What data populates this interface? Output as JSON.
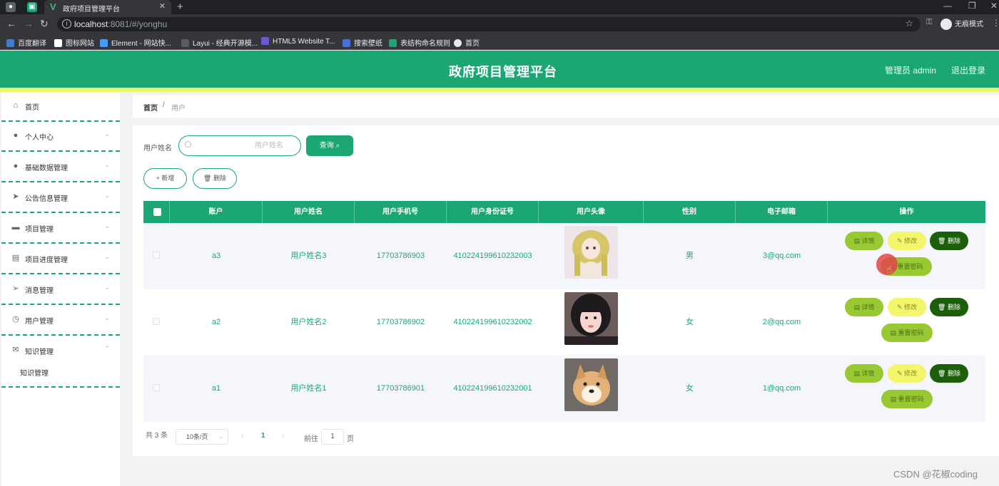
{
  "browser": {
    "tab_title": "政府项目管理平台",
    "url_host": "localhost",
    "url_rest": ":8081/#/yonghu",
    "incognito_label": "无痕模式",
    "bookmarks": [
      "百度翻译",
      "图标网站",
      "Element - 网站快...",
      "Layui - 经典开源模...",
      "HTML5 Website T...",
      "搜索壁纸",
      "表结构命名规则",
      "首页"
    ]
  },
  "header": {
    "title": "政府项目管理平台",
    "user": "管理员 admin",
    "logout": "退出登录"
  },
  "sidebar": {
    "items": [
      {
        "label": "首页",
        "icon": "home-icon"
      },
      {
        "label": "个人中心",
        "icon": "user-icon"
      },
      {
        "label": "基础数据管理",
        "icon": "user-icon"
      },
      {
        "label": "公告信息管理",
        "icon": "send-icon"
      },
      {
        "label": "项目管理",
        "icon": "chat-icon"
      },
      {
        "label": "项目进度管理",
        "icon": "clipboard-icon"
      },
      {
        "label": "消息管理",
        "icon": "send-icon"
      },
      {
        "label": "用户管理",
        "icon": "clock-icon"
      },
      {
        "label": "知识管理",
        "icon": "mail-icon"
      }
    ],
    "sub_item": "知识管理"
  },
  "breadcrumb": {
    "home": "首页",
    "separator": "/",
    "current": "用户"
  },
  "search": {
    "label": "用户姓名",
    "placeholder": "用户姓名",
    "button": "查询"
  },
  "actions": {
    "add": "+ 新增",
    "delete": "删除"
  },
  "table": {
    "columns": [
      "账户",
      "用户姓名",
      "用户手机号",
      "用户身份证号",
      "用户头像",
      "性别",
      "电子邮箱",
      "操作"
    ],
    "rows": [
      {
        "account": "a3",
        "name": "用户姓名3",
        "phone": "17703786903",
        "id_card": "410224199610232003",
        "gender": "男",
        "email": "3@qq.com",
        "avatar": "anime-doll-avatar"
      },
      {
        "account": "a2",
        "name": "用户姓名2",
        "phone": "17703786902",
        "id_card": "410224199610232002",
        "gender": "女",
        "email": "2@qq.com",
        "avatar": "girl-portrait-avatar"
      },
      {
        "account": "a1",
        "name": "用户姓名1",
        "phone": "17703786901",
        "id_card": "410224199610232001",
        "gender": "女",
        "email": "1@qq.com",
        "avatar": "shiba-dog-avatar"
      }
    ],
    "ops": {
      "detail": "详情",
      "edit": "修改",
      "delete": "删除",
      "reset": "重置密码"
    }
  },
  "pagination": {
    "total": "共 3 条",
    "page_size": "10条/页",
    "current": "1",
    "goto_label": "前往",
    "goto_value": "1",
    "page_suffix": "页"
  },
  "watermark": "CSDN @花椒coding",
  "colors": {
    "primary": "#1aa774",
    "accent_strip": "#eaf56a",
    "detail_btn": "#98c933",
    "edit_btn": "#f3f56a",
    "delete_btn": "#1c5e0a"
  }
}
